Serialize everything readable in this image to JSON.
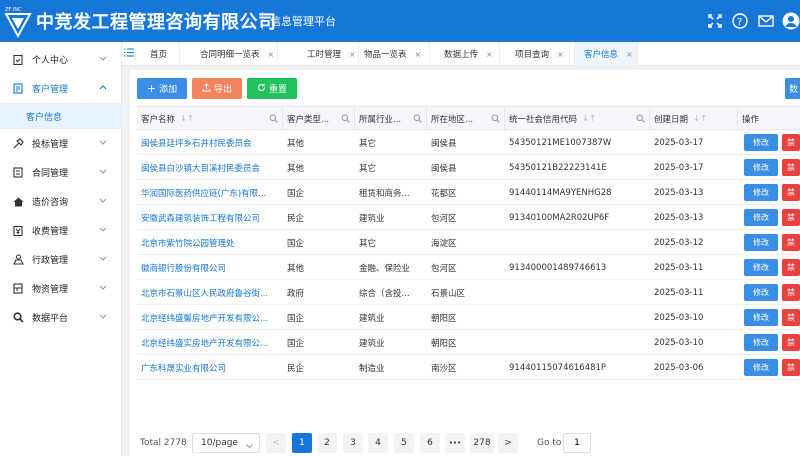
{
  "header": {
    "logo_text": "ZF INC",
    "brand": "中竞发工程管理咨询有限公司",
    "subtitle": "信息管理平台"
  },
  "sidebar": {
    "items": [
      {
        "label": "个人中心",
        "icon": "clipboard-icon"
      },
      {
        "label": "客户管理",
        "icon": "document-icon",
        "active": true
      },
      {
        "label": "投标管理",
        "icon": "hammer-icon"
      },
      {
        "label": "合同管理",
        "icon": "contract-icon"
      },
      {
        "label": "造价咨询",
        "icon": "home-icon"
      },
      {
        "label": "收费管理",
        "icon": "payment-icon"
      },
      {
        "label": "行政管理",
        "icon": "admin-icon"
      },
      {
        "label": "物资管理",
        "icon": "box-icon"
      },
      {
        "label": "数据平台",
        "icon": "search-icon"
      }
    ],
    "sub_item": "客户信息"
  },
  "tabs": [
    {
      "label": "首页",
      "closable": false
    },
    {
      "label": "合同明细一览表",
      "closable": true
    },
    {
      "label": "工时管理",
      "closable": true
    },
    {
      "label": "物品一览表",
      "closable": true
    },
    {
      "label": "数据上传",
      "closable": true
    },
    {
      "label": "项目查询",
      "closable": true
    },
    {
      "label": "客户信息",
      "closable": true,
      "active": true
    }
  ],
  "toolbar": {
    "add": "添加",
    "export": "导出",
    "reset": "重置",
    "right_partial": "数"
  },
  "table": {
    "columns": [
      "客户名称",
      "客户类型...",
      "所属行业...",
      "所在地区...",
      "统一社会信用代码",
      "创建日期",
      "操作"
    ],
    "rows": [
      {
        "name": "闽侯县廷坪乡石井村民委员会",
        "type": "其他",
        "industry": "其它",
        "region": "闽侯县",
        "code": "54350121ME1007387W",
        "date": "2025-03-17"
      },
      {
        "name": "闽侯县白沙镇大目溪村民委员会",
        "type": "其他",
        "industry": "其它",
        "region": "闽侯县",
        "code": "54350121B22223141E",
        "date": "2025-03-17"
      },
      {
        "name": "华润国际医药供应链(广东)有限...",
        "type": "国企",
        "industry": "租赁和商务...",
        "region": "花都区",
        "code": "91440114MA9YENHG28",
        "date": "2025-03-13"
      },
      {
        "name": "安徽武森建筑装饰工程有限公司",
        "type": "民企",
        "industry": "建筑业",
        "region": "包河区",
        "code": "91340100MA2R02UP6F",
        "date": "2025-03-13"
      },
      {
        "name": "北京市紫竹院公园管理处",
        "type": "国企",
        "industry": "其它",
        "region": "海淀区",
        "code": "",
        "date": "2025-03-12"
      },
      {
        "name": "徽商银行股份有限公司",
        "type": "其他",
        "industry": "金融、保险业",
        "region": "包河区",
        "code": "913400001489746613",
        "date": "2025-03-11"
      },
      {
        "name": "北京市石景山区人民政府鲁谷街...",
        "type": "政府",
        "industry": "综合（含投...",
        "region": "石景山区",
        "code": "",
        "date": "2025-03-11"
      },
      {
        "name": "北京经纬盛馨房地产开发有限公...",
        "type": "国企",
        "industry": "建筑业",
        "region": "朝阳区",
        "code": "",
        "date": "2025-03-10"
      },
      {
        "name": "北京经纬盛实房地产开发有限公...",
        "type": "国企",
        "industry": "建筑业",
        "region": "朝阳区",
        "code": "",
        "date": "2025-03-10"
      },
      {
        "name": "广东科晟实业有限公司",
        "type": "民企",
        "industry": "制造业",
        "region": "南沙区",
        "code": "91440115074616481P",
        "date": "2025-03-06"
      }
    ],
    "edit_label": "修改",
    "disable_label": "禁"
  },
  "pager": {
    "total": "Total 2778",
    "page_size": "10/page",
    "prev": "<",
    "pages": [
      "1",
      "2",
      "3",
      "4",
      "5",
      "6",
      "•••",
      "278"
    ],
    "current": "1",
    "next": ">",
    "goto_label": "Go to",
    "goto_value": "1"
  },
  "colors": {
    "primary": "#1677d8",
    "add": "#3a8ee6",
    "export": "#f5845c",
    "reset": "#22c35e",
    "danger": "#e94040"
  }
}
